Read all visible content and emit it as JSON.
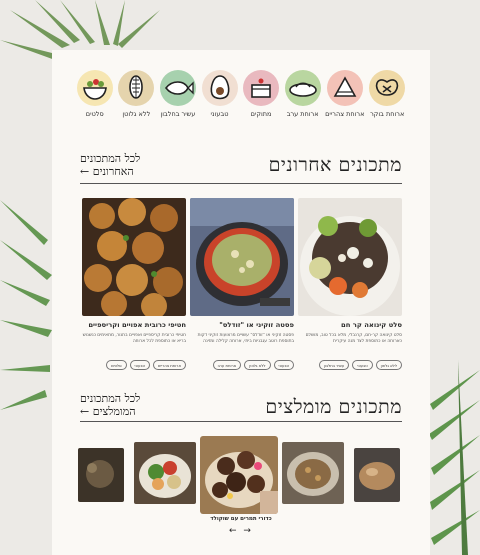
{
  "categories": [
    {
      "label": "ארוחת בוקר",
      "color": "#efd9a6",
      "icon": "pretzel-icon"
    },
    {
      "label": "ארוחת צהריים",
      "color": "#f3c2b7",
      "icon": "sandwich-icon"
    },
    {
      "label": "ארוחת ערב",
      "color": "#b9d6a0",
      "icon": "plate-icon"
    },
    {
      "label": "מתוקים",
      "color": "#e9b9bf",
      "icon": "cake-icon"
    },
    {
      "label": "טבעוני",
      "color": "#f1dfd2",
      "icon": "avocado-icon"
    },
    {
      "label": "עשיר בחלבון",
      "color": "#a7d1ae",
      "icon": "fish-icon"
    },
    {
      "label": "ללא גלוטן",
      "color": "#e5d4ad",
      "icon": "corn-icon"
    },
    {
      "label": "סלטים",
      "color": "#f6e6b2",
      "icon": "salad-bowl-icon"
    }
  ],
  "latest": {
    "title": "מתכונים אחרונים",
    "link_line1": "לכל המתכונים",
    "link_line2": "האחרונים ←"
  },
  "recipes": [
    {
      "title": "סלט קינואה קר חם",
      "desc": "סלט קינואה קר-חם, קרנבלי, מלא בכל טוב, מושלם כארוחה או כתוספת לצד מנה עיקרית",
      "tags": [
        "ללא גלוטן",
        "טבעוני",
        "עשיר בחלבון"
      ]
    },
    {
      "title": "פסטה זוקיני או \"זודלס\"",
      "desc": "פסטה זוקיני או \"זודלס\" עשויים מרצועות זוקיני דקות בתוספת רוטב עגבניות ביתי, ארוחה קלילה ומזינה",
      "tags": [
        "טבעוני",
        "ללא גלוטן",
        "ארוחת ערב"
      ]
    },
    {
      "title": "חטיפי כרובית אפויים וקריספיים",
      "desc": "חטיפי כרובית קריספיים ואפויים בתנור, מתאימים כנשנוש בריא או כתוספת לכל ארוחה",
      "tags": [
        "ארוחת צהריים",
        "טבעוני",
        "סלטים"
      ]
    }
  ],
  "featured": {
    "title": "מתכונים מומלצים",
    "link_line1": "לכל המתכונים",
    "link_line2": "המומלצים ←",
    "caption": "כדורי תמרים עם שוקולד",
    "prev": "←",
    "next": "→"
  }
}
